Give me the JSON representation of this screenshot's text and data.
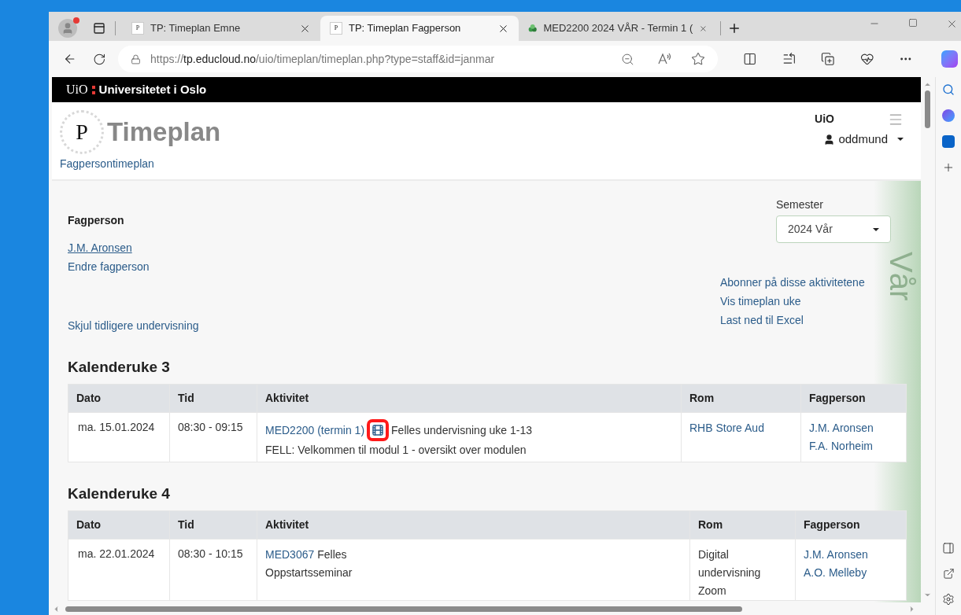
{
  "browser": {
    "tabs": [
      {
        "title": "TP: Timeplan Emne",
        "selected": false,
        "favicon": "P"
      },
      {
        "title": "TP: Timeplan Fagperson",
        "selected": true,
        "favicon": "P"
      },
      {
        "title": "MED2200 2024 VÅR - Termin 1 (",
        "selected": false
      }
    ],
    "url_prefix": "https://",
    "url_host": "tp.educloud.no",
    "url_path": "/uio/timeplan/timeplan.php?type=staff&id=janmar"
  },
  "page": {
    "brand_mark": "UiO",
    "brand_name": "Universitetet i Oslo",
    "logo_letter": "P",
    "title": "Timeplan",
    "subtitle": "Fagpersontimeplan",
    "org": "UiO",
    "user": "oddmund",
    "section_heading": "Fagperson",
    "person": "J.M. Aronsen",
    "change_person": "Endre fagperson",
    "semester_label": "Semester",
    "semester_value": "2024 Vår",
    "actions": [
      "Abonner på disse aktivitetene",
      "Vis timeplan uke",
      "Last ned til Excel"
    ],
    "season_text": "Vår",
    "hide_link": "Skjul tidligere undervisning",
    "weeks": [
      {
        "heading": "Kalenderuke 3",
        "columns": [
          "Dato",
          "Tid",
          "Aktivitet",
          "Rom",
          "Fagperson"
        ],
        "rows": [
          {
            "date": "ma. 15.01.2024",
            "time": "08:30 - 09:15",
            "course": "MED2200 (termin 1)",
            "video": true,
            "highlighted": true,
            "title": "Felles undervisning uke 1-13",
            "detail": "FELL: Velkommen til modul 1 - oversikt over modulen",
            "room": {
              "lines": [
                "RHB Store Aud"
              ],
              "link": true
            },
            "staff": [
              "J.M. Aronsen",
              "F.A. Norheim"
            ]
          }
        ]
      },
      {
        "heading": "Kalenderuke 4",
        "columns": [
          "Dato",
          "Tid",
          "Aktivitet",
          "Rom",
          "Fagperson"
        ],
        "rows": [
          {
            "date": "ma. 22.01.2024",
            "time": "08:30 - 10:15",
            "course": "MED3067",
            "video": false,
            "highlighted": false,
            "title": "Felles",
            "detail": "Oppstartsseminar",
            "room": {
              "lines": [
                "Digital undervisning",
                "Zoom"
              ],
              "link": false
            },
            "staff": [
              "J.M. Aronsen",
              "A.O. Melleby"
            ]
          }
        ]
      }
    ]
  }
}
